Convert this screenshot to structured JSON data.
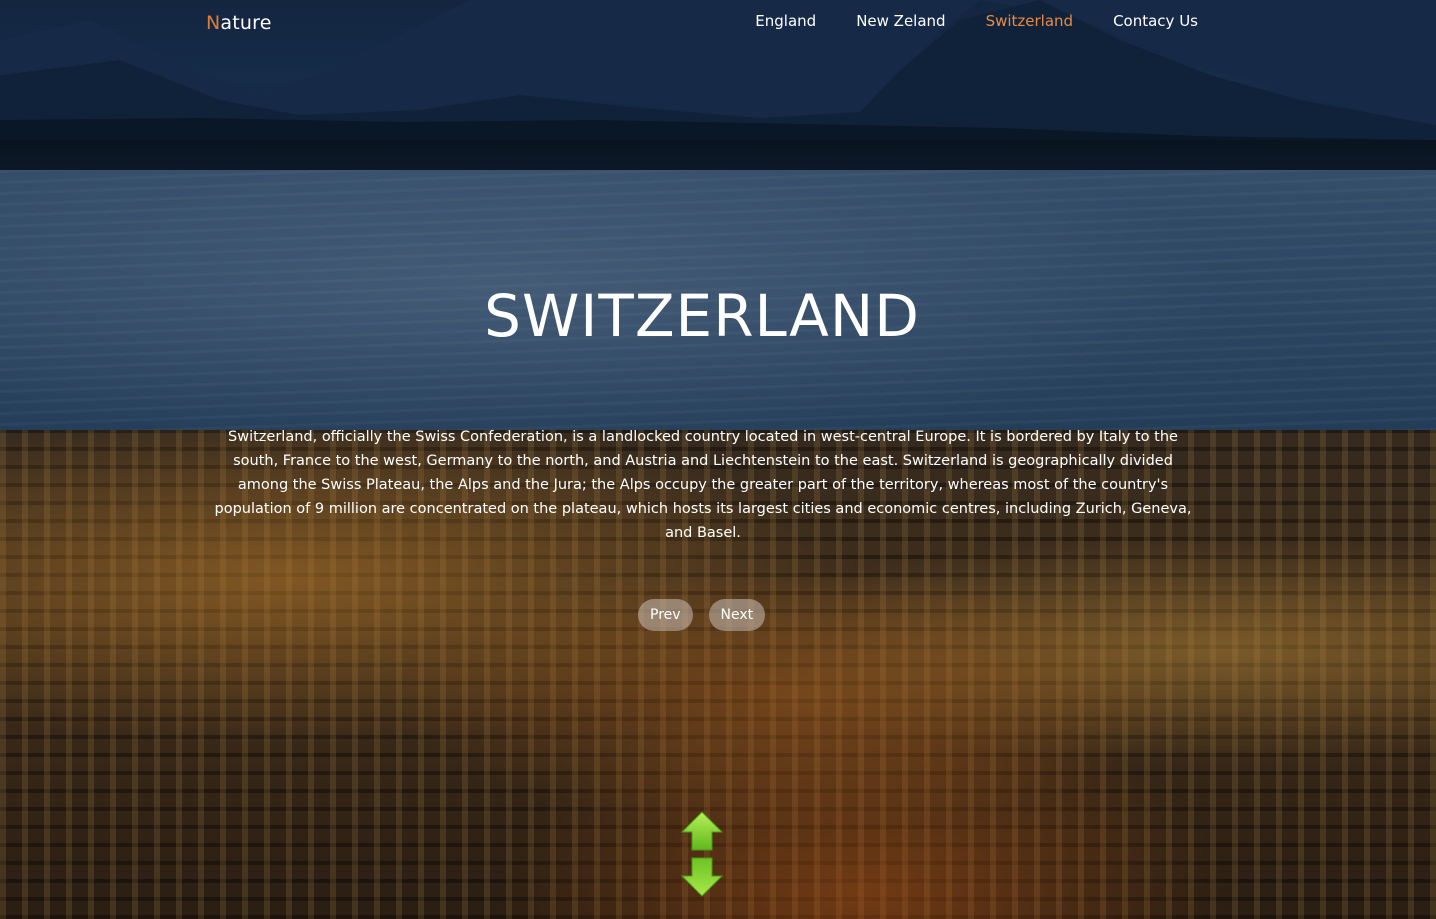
{
  "navbar": {
    "logo_first": "N",
    "logo_rest": "ature",
    "items": [
      {
        "label": "England",
        "active": false
      },
      {
        "label": "New Zeland",
        "active": false
      },
      {
        "label": "Switzerland",
        "active": true
      },
      {
        "label": "Contacy Us",
        "active": false
      }
    ]
  },
  "hero": {
    "title": "SWITZERLAND",
    "description": "Switzerland, officially the Swiss Confederation, is a landlocked country located in west-central Europe. It is bordered by Italy to the south, France to the west, Germany to the north, and Austria and Liechtenstein to the east. Switzerland is geographically divided among the Swiss Plateau, the Alps and the Jura; the Alps occupy the greater part of the territory, whereas most of the country's population of 9 million are concentrated on the plateau, which hosts its largest cities and economic centres, including Zurich, Geneva, and Basel.",
    "prev_label": "Prev",
    "next_label": "Next"
  },
  "icons": {
    "scroll": "up-down-arrow-icon"
  },
  "colors": {
    "accent": "#e98a45",
    "logo_accent": "#e07a3b",
    "arrow_green": "#7ed321"
  }
}
